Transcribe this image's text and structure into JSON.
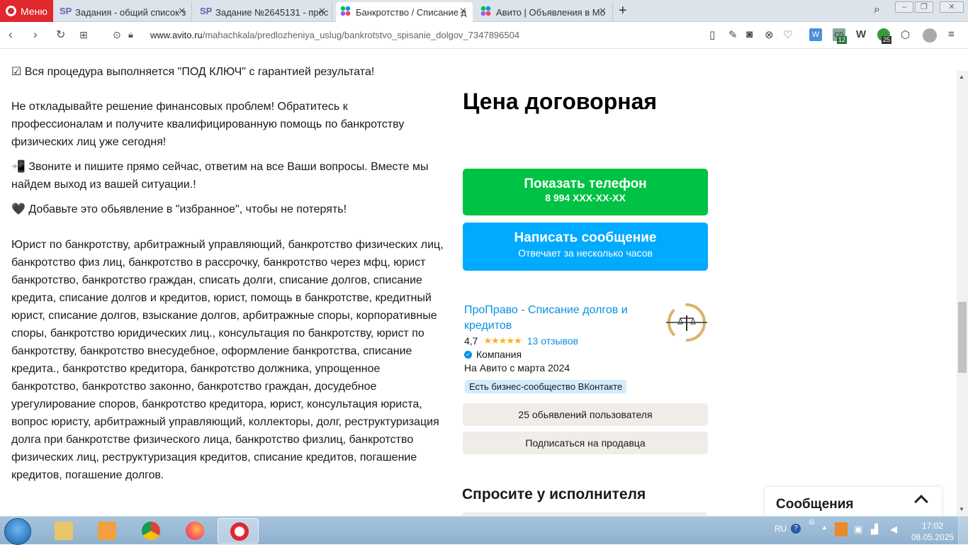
{
  "browser": {
    "menu_label": "Меню",
    "tabs": [
      {
        "title": "Задания - общий список з",
        "icon": "sp-icon"
      },
      {
        "title": "Задание №2645131 - прос",
        "icon": "sp-icon"
      },
      {
        "title": "Банкротство / Списание д",
        "icon": "avito-icon",
        "active": true
      },
      {
        "title": "Авито | Объявления в Мо",
        "icon": "avito-icon"
      }
    ],
    "url_domain": "www.avito.ru",
    "url_path": "/mahachkala/predlozheniya_uslug/bankrotstvo_spisanie_dolgov_7347896504",
    "ext_badges": {
      "cd": "12",
      "green": "25"
    }
  },
  "listing": {
    "top_partial": "☑ Вся процедура выполняется \"ПОД КЛЮЧ\" с гарантией результата!",
    "para1": "Не откладывайте решение финансовых проблем! Обратитесь к профессионалам и получите квалифицированную помощь по банкротству физических лиц уже сегодня!",
    "para2": "📲 Звоните и пишите прямо сейчас, ответим на все Ваши вопросы. Вместе мы найдем выход из вашей ситуации.!",
    "para3": "🖤 Добавьте это обьявление в \"избранное\", чтобы не потерять!",
    "keywords": "Юрист по банкротству, арбитражный управляющий, банкротство физических лиц, банкротство физ лиц, банкротство в рассрочку, банкротство через мфц, юрист банкротство, банкротство граждан, списать долги, списание долгов, списание кредита, списание долгов и кредитов, юрист, помощь в банкротстве, кредитный юрист, списание долгов, взыскание долгов, арбитражные споры, корпоративные споры, банкротство юридических лиц., консультация по банкротству, юрист по банкротству, банкротство внесудебное, оформление банкротства, списание кредита., банкротство кредитора, банкротство должника, упрощенное банкротство, банкротство законно, банкротство граждан, досудебное урегулирование споров, банкротство кредитора, юрист, консультация юриста, вопрос юристу, арбитражный управляющий, коллекторы, долг, реструктуризация долга при банкротстве физического лица, банкротство физлиц, банкротство физических лиц, реструктуризация кредитов, списание кредитов, погашение кредитов, погашение долгов."
  },
  "sidebar": {
    "price": "Цена договорная",
    "phone_button": {
      "title": "Показать телефон",
      "subtitle": "8 994 XXX-XX-XX"
    },
    "message_button": {
      "title": "Написать сообщение",
      "subtitle": "Отвечает за несколько часов"
    },
    "seller": {
      "name": "ПроПраво - Списание долгов и кредитов",
      "rating": "4,7",
      "reviews": "13 отзывов",
      "type": "Компания",
      "since": "На Авито с марта 2024",
      "vk_badge": "Есть бизнес-сообщество ВКонтакте"
    },
    "listings_button": "25 обьявлений пользователя",
    "subscribe_button": "Подписаться на продавца",
    "ask_title": "Спросите у исполнителя"
  },
  "messages_panel": {
    "title": "Сообщения"
  },
  "taskbar": {
    "lang": "RU",
    "time": "17:02",
    "date": "08.05.2025"
  },
  "colors": {
    "green": "#00c244",
    "blue": "#00aaff",
    "link": "#0a91e0",
    "opera_red": "#e0282e"
  }
}
